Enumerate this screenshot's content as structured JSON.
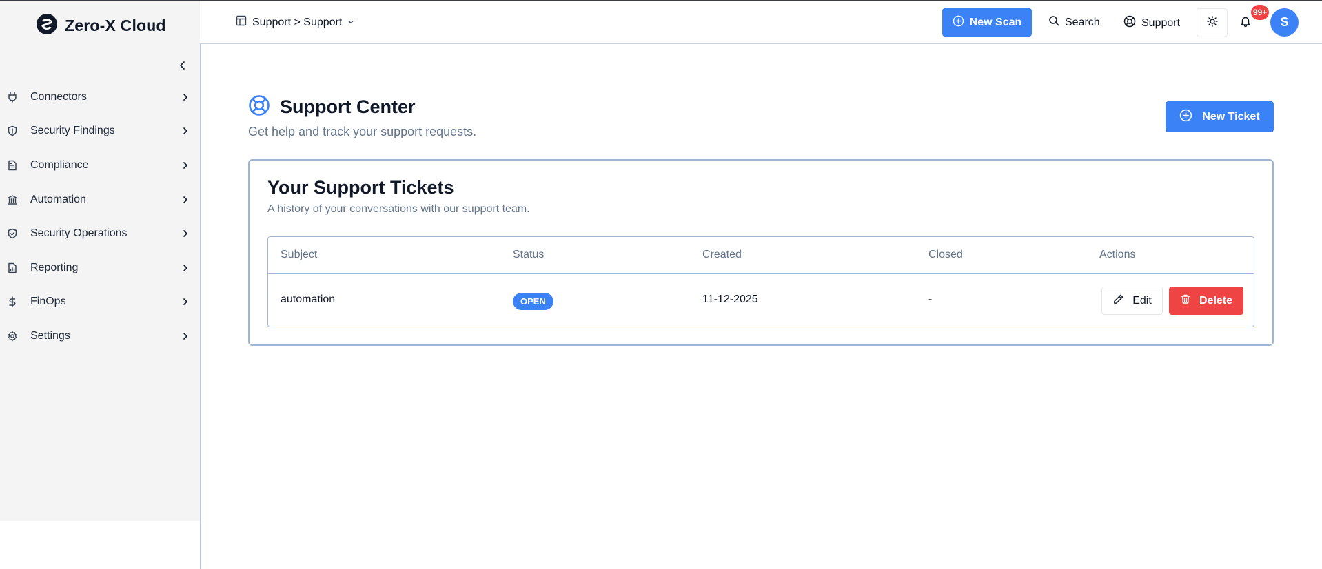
{
  "app": {
    "brand_name": "Zero-X Cloud",
    "accent_color": "#3b82f6",
    "danger_color": "#ef4444"
  },
  "sidebar": {
    "collapse_icon": "chevron-left-icon",
    "items": [
      {
        "label": "Connectors",
        "icon": "plug-icon"
      },
      {
        "label": "Security Findings",
        "icon": "shield-icon"
      },
      {
        "label": "Compliance",
        "icon": "document-icon"
      },
      {
        "label": "Automation",
        "icon": "bank-icon"
      },
      {
        "label": "Security Operations",
        "icon": "shield-check-icon"
      },
      {
        "label": "Reporting",
        "icon": "report-icon"
      },
      {
        "label": "FinOps",
        "icon": "dollar-icon"
      },
      {
        "label": "Settings",
        "icon": "gear-icon"
      }
    ]
  },
  "header": {
    "breadcrumb": "Support > Support",
    "new_scan_label": "New Scan",
    "search_label": "Search",
    "support_label": "Support",
    "notification_badge": "99+",
    "avatar_initial": "S"
  },
  "main": {
    "title": "Support Center",
    "subtitle": "Get help and track your support requests.",
    "new_ticket_label": "New Ticket",
    "card": {
      "title": "Your Support Tickets",
      "subtitle": "A history of your conversations with our support team.",
      "columns": [
        "Subject",
        "Status",
        "Created",
        "Closed",
        "Actions"
      ],
      "rows": [
        {
          "subject": "automation",
          "status": "OPEN",
          "created": "11-12-2025",
          "closed": "-",
          "edit_label": "Edit",
          "delete_label": "Delete"
        }
      ]
    }
  }
}
